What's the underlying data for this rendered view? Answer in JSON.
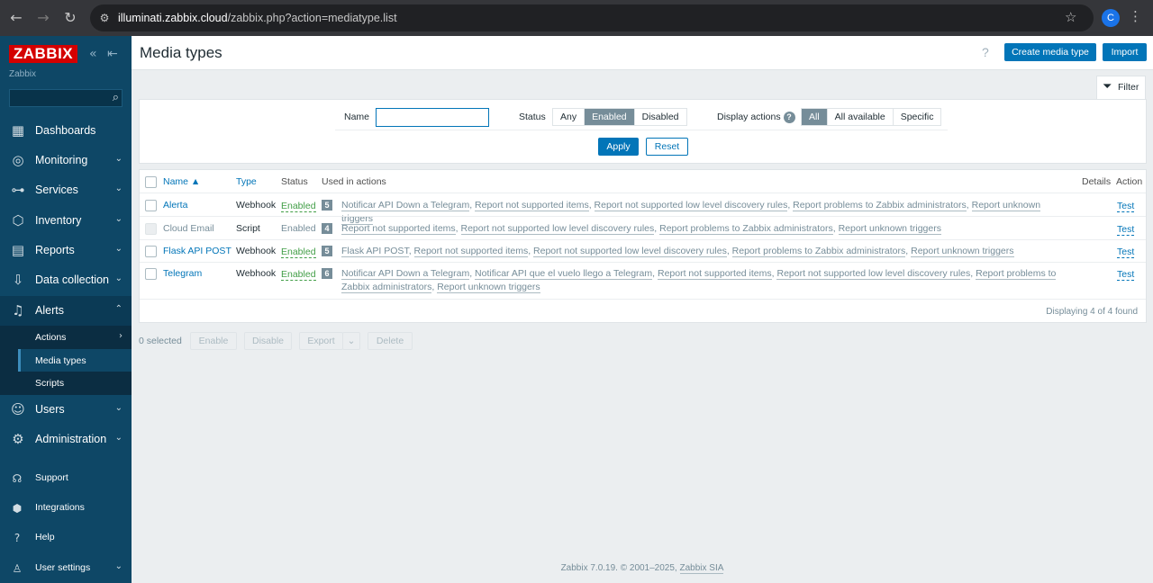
{
  "browser": {
    "url_host": "illuminati.zabbix.cloud",
    "url_path": "/zabbix.php?action=mediatype.list",
    "profile_initial": "C"
  },
  "sidebar": {
    "logo": "ZABBIX",
    "server_name": "Zabbix",
    "menu": [
      {
        "label": "Dashboards",
        "icon": "dashboard-icon"
      },
      {
        "label": "Monitoring",
        "icon": "monitoring-icon"
      },
      {
        "label": "Services",
        "icon": "services-icon"
      },
      {
        "label": "Inventory",
        "icon": "inventory-icon"
      },
      {
        "label": "Reports",
        "icon": "reports-icon"
      },
      {
        "label": "Data collection",
        "icon": "data-collection-icon"
      },
      {
        "label": "Alerts",
        "icon": "bell-icon"
      },
      {
        "label": "Users",
        "icon": "users-icon"
      },
      {
        "label": "Administration",
        "icon": "gear-icon"
      }
    ],
    "alerts_submenu": [
      {
        "label": "Actions"
      },
      {
        "label": "Media types"
      },
      {
        "label": "Scripts"
      }
    ],
    "bottom": [
      {
        "label": "Support",
        "icon": "headset-icon"
      },
      {
        "label": "Integrations",
        "icon": "integrations-icon"
      },
      {
        "label": "Help",
        "icon": "help-icon"
      },
      {
        "label": "User settings",
        "icon": "user-icon"
      }
    ]
  },
  "header": {
    "title": "Media types",
    "create_button": "Create media type",
    "import_button": "Import"
  },
  "filter": {
    "tab_label": "Filter",
    "name_label": "Name",
    "name_value": "",
    "status_label": "Status",
    "status_options": [
      "Any",
      "Enabled",
      "Disabled"
    ],
    "status_selected": "Enabled",
    "display_actions_label": "Display actions",
    "display_actions_options": [
      "All",
      "All available",
      "Specific"
    ],
    "display_actions_selected": "All",
    "apply": "Apply",
    "reset": "Reset"
  },
  "table": {
    "headers": {
      "name": "Name ▲",
      "type": "Type",
      "status": "Status",
      "used_in": "Used in actions",
      "details": "Details",
      "action": "Action"
    },
    "rows": [
      {
        "name": "Alerta",
        "type": "Webhook",
        "status": "Enabled",
        "count": "5",
        "actions": [
          "Notificar API Down a Telegram",
          "Report not supported items",
          "Report not supported low level discovery rules",
          "Report problems to Zabbix administrators",
          "Report unknown triggers"
        ],
        "test": "Test",
        "disabled": false
      },
      {
        "name": "Cloud Email",
        "type": "Script",
        "status": "Enabled",
        "count": "4",
        "actions": [
          "Report not supported items",
          "Report not supported low level discovery rules",
          "Report problems to Zabbix administrators",
          "Report unknown triggers"
        ],
        "test": "Test",
        "disabled": true
      },
      {
        "name": "Flask API POST",
        "type": "Webhook",
        "status": "Enabled",
        "count": "5",
        "actions": [
          "Flask API POST",
          "Report not supported items",
          "Report not supported low level discovery rules",
          "Report problems to Zabbix administrators",
          "Report unknown triggers"
        ],
        "test": "Test",
        "disabled": false
      },
      {
        "name": "Telegram",
        "type": "Webhook",
        "status": "Enabled",
        "count": "6",
        "actions": [
          "Notificar API Down a Telegram",
          "Notificar API que el vuelo llego a Telegram",
          "Report not supported items",
          "Report not supported low level discovery rules",
          "Report problems to Zabbix administrators",
          "Report unknown triggers"
        ],
        "test": "Test",
        "disabled": false
      }
    ],
    "footer": "Displaying 4 of 4 found"
  },
  "bulk": {
    "selected": "0 selected",
    "enable": "Enable",
    "disable": "Disable",
    "export": "Export",
    "delete": "Delete"
  },
  "footer": {
    "text": "Zabbix 7.0.19. © 2001–2025, ",
    "link": "Zabbix SIA"
  },
  "colors": {
    "sidebar": "#0e4766",
    "primary": "#0275b8",
    "enabled": "#429e47",
    "logo": "#d40000"
  }
}
